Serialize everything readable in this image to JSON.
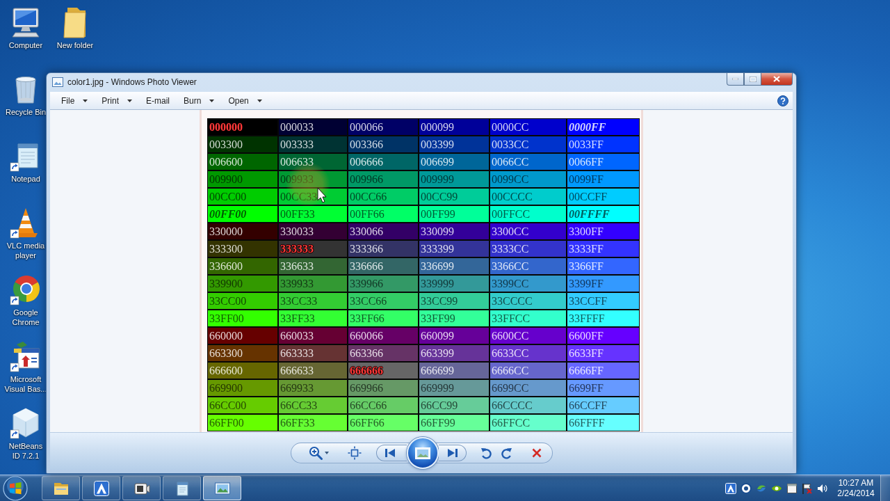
{
  "desktop": {
    "icons": [
      {
        "label": "Computer",
        "kind": "computer",
        "shortcut": false
      },
      {
        "label": "Recycle Bin",
        "kind": "recycle_bin",
        "shortcut": false
      },
      {
        "label": "Notepad",
        "kind": "notepad",
        "shortcut": true
      },
      {
        "label": "VLC media player",
        "kind": "cone",
        "shortcut": true
      },
      {
        "label": "Google Chrome",
        "kind": "browser",
        "shortcut": true
      },
      {
        "label": "Microsoft Visual Bas...",
        "kind": "vb",
        "shortcut": true
      },
      {
        "label": "NetBeans ID 7.2.1",
        "kind": "cube",
        "shortcut": true
      },
      {
        "label": "New folder",
        "kind": "folder",
        "shortcut": false
      }
    ]
  },
  "window": {
    "title": "color1.jpg - Windows Photo Viewer",
    "menu": [
      {
        "label": "File",
        "dropdown": true
      },
      {
        "label": "Print",
        "dropdown": true
      },
      {
        "label": "E-mail",
        "dropdown": false
      },
      {
        "label": "Burn",
        "dropdown": true
      },
      {
        "label": "Open",
        "dropdown": true
      }
    ],
    "image": {
      "table": {
        "rows": [
          {
            "cells": [
              {
                "text": "000000",
                "color": "#000000",
                "kind": "highlight"
              },
              {
                "text": "000033",
                "color": "#000033",
                "kind": "plain"
              },
              {
                "text": "000066",
                "color": "#000066",
                "kind": "plain"
              },
              {
                "text": "000099",
                "color": "#000099",
                "kind": "plain"
              },
              {
                "text": "0000CC",
                "color": "#0000CC",
                "kind": "plain"
              },
              {
                "text": "0000FF",
                "color": "#0000FF",
                "kind": "emphasis"
              }
            ]
          },
          {
            "cells": [
              {
                "text": "003300",
                "color": "#003300",
                "kind": "plain"
              },
              {
                "text": "003333",
                "color": "#003333",
                "kind": "plain"
              },
              {
                "text": "003366",
                "color": "#003366",
                "kind": "plain"
              },
              {
                "text": "003399",
                "color": "#003399",
                "kind": "plain"
              },
              {
                "text": "0033CC",
                "color": "#0033CC",
                "kind": "plain"
              },
              {
                "text": "0033FF",
                "color": "#0033FF",
                "kind": "plain"
              }
            ]
          },
          {
            "cells": [
              {
                "text": "006600",
                "color": "#006600",
                "kind": "plain"
              },
              {
                "text": "006633",
                "color": "#006633",
                "kind": "plain"
              },
              {
                "text": "006666",
                "color": "#006666",
                "kind": "plain"
              },
              {
                "text": "006699",
                "color": "#006699",
                "kind": "plain"
              },
              {
                "text": "0066CC",
                "color": "#0066CC",
                "kind": "plain"
              },
              {
                "text": "0066FF",
                "color": "#0066FF",
                "kind": "plain"
              }
            ]
          },
          {
            "cells": [
              {
                "text": "009900",
                "color": "#009900",
                "kind": "plain"
              },
              {
                "text": "009933",
                "color": "#009933",
                "kind": "plain"
              },
              {
                "text": "009966",
                "color": "#009966",
                "kind": "plain"
              },
              {
                "text": "009999",
                "color": "#009999",
                "kind": "plain"
              },
              {
                "text": "0099CC",
                "color": "#0099CC",
                "kind": "plain"
              },
              {
                "text": "0099FF",
                "color": "#0099FF",
                "kind": "plain"
              }
            ]
          },
          {
            "cells": [
              {
                "text": "00CC00",
                "color": "#00CC00",
                "kind": "plain"
              },
              {
                "text": "00CC33",
                "color": "#00CC33",
                "kind": "plain"
              },
              {
                "text": "00CC66",
                "color": "#00CC66",
                "kind": "plain"
              },
              {
                "text": "00CC99",
                "color": "#00CC99",
                "kind": "plain"
              },
              {
                "text": "00CCCC",
                "color": "#00CCCC",
                "kind": "plain"
              },
              {
                "text": "00CCFF",
                "color": "#00CCFF",
                "kind": "plain"
              }
            ]
          },
          {
            "cells": [
              {
                "text": "00FF00",
                "color": "#00FF00",
                "kind": "emphasis"
              },
              {
                "text": "00FF33",
                "color": "#00FF33",
                "kind": "plain"
              },
              {
                "text": "00FF66",
                "color": "#00FF66",
                "kind": "plain"
              },
              {
                "text": "00FF99",
                "color": "#00FF99",
                "kind": "plain"
              },
              {
                "text": "00FFCC",
                "color": "#00FFCC",
                "kind": "plain"
              },
              {
                "text": "00FFFF",
                "color": "#00FFFF",
                "kind": "emphasis"
              }
            ]
          },
          {
            "cells": [
              {
                "text": "330000",
                "color": "#330000",
                "kind": "plain"
              },
              {
                "text": "330033",
                "color": "#330033",
                "kind": "plain"
              },
              {
                "text": "330066",
                "color": "#330066",
                "kind": "plain"
              },
              {
                "text": "330099",
                "color": "#330099",
                "kind": "plain"
              },
              {
                "text": "3300CC",
                "color": "#3300CC",
                "kind": "plain"
              },
              {
                "text": "3300FF",
                "color": "#3300FF",
                "kind": "plain"
              }
            ]
          },
          {
            "cells": [
              {
                "text": "333300",
                "color": "#333300",
                "kind": "plain"
              },
              {
                "text": "333333",
                "color": "#333333",
                "kind": "highlight"
              },
              {
                "text": "333366",
                "color": "#333366",
                "kind": "plain"
              },
              {
                "text": "333399",
                "color": "#333399",
                "kind": "plain"
              },
              {
                "text": "3333CC",
                "color": "#3333CC",
                "kind": "plain"
              },
              {
                "text": "3333FF",
                "color": "#3333FF",
                "kind": "plain"
              }
            ]
          },
          {
            "cells": [
              {
                "text": "336600",
                "color": "#336600",
                "kind": "plain"
              },
              {
                "text": "336633",
                "color": "#336633",
                "kind": "plain"
              },
              {
                "text": "336666",
                "color": "#336666",
                "kind": "plain"
              },
              {
                "text": "336699",
                "color": "#336699",
                "kind": "plain"
              },
              {
                "text": "3366CC",
                "color": "#3366CC",
                "kind": "plain"
              },
              {
                "text": "3366FF",
                "color": "#3366FF",
                "kind": "plain"
              }
            ]
          },
          {
            "cells": [
              {
                "text": "339900",
                "color": "#339900",
                "kind": "plain"
              },
              {
                "text": "339933",
                "color": "#339933",
                "kind": "plain"
              },
              {
                "text": "339966",
                "color": "#339966",
                "kind": "plain"
              },
              {
                "text": "339999",
                "color": "#339999",
                "kind": "plain"
              },
              {
                "text": "3399CC",
                "color": "#3399CC",
                "kind": "plain"
              },
              {
                "text": "3399FF",
                "color": "#3399FF",
                "kind": "plain"
              }
            ]
          },
          {
            "cells": [
              {
                "text": "33CC00",
                "color": "#33CC00",
                "kind": "plain"
              },
              {
                "text": "33CC33",
                "color": "#33CC33",
                "kind": "plain"
              },
              {
                "text": "33CC66",
                "color": "#33CC66",
                "kind": "plain"
              },
              {
                "text": "33CC99",
                "color": "#33CC99",
                "kind": "plain"
              },
              {
                "text": "33CCCC",
                "color": "#33CCCC",
                "kind": "plain"
              },
              {
                "text": "33CCFF",
                "color": "#33CCFF",
                "kind": "plain"
              }
            ]
          },
          {
            "cells": [
              {
                "text": "33FF00",
                "color": "#33FF00",
                "kind": "plain"
              },
              {
                "text": "33FF33",
                "color": "#33FF33",
                "kind": "plain"
              },
              {
                "text": "33FF66",
                "color": "#33FF66",
                "kind": "plain"
              },
              {
                "text": "33FF99",
                "color": "#33FF99",
                "kind": "plain"
              },
              {
                "text": "33FFCC",
                "color": "#33FFCC",
                "kind": "plain"
              },
              {
                "text": "33FFFF",
                "color": "#33FFFF",
                "kind": "plain"
              }
            ]
          },
          {
            "cells": [
              {
                "text": "660000",
                "color": "#660000",
                "kind": "plain"
              },
              {
                "text": "660033",
                "color": "#660033",
                "kind": "plain"
              },
              {
                "text": "660066",
                "color": "#660066",
                "kind": "plain"
              },
              {
                "text": "660099",
                "color": "#660099",
                "kind": "plain"
              },
              {
                "text": "6600CC",
                "color": "#6600CC",
                "kind": "plain"
              },
              {
                "text": "6600FF",
                "color": "#6600FF",
                "kind": "plain"
              }
            ]
          },
          {
            "cells": [
              {
                "text": "663300",
                "color": "#663300",
                "kind": "plain"
              },
              {
                "text": "663333",
                "color": "#663333",
                "kind": "plain"
              },
              {
                "text": "663366",
                "color": "#663366",
                "kind": "plain"
              },
              {
                "text": "663399",
                "color": "#663399",
                "kind": "plain"
              },
              {
                "text": "6633CC",
                "color": "#6633CC",
                "kind": "plain"
              },
              {
                "text": "6633FF",
                "color": "#6633FF",
                "kind": "plain"
              }
            ]
          },
          {
            "cells": [
              {
                "text": "666600",
                "color": "#666600",
                "kind": "plain"
              },
              {
                "text": "666633",
                "color": "#666633",
                "kind": "plain"
              },
              {
                "text": "666666",
                "color": "#666666",
                "kind": "highlight"
              },
              {
                "text": "666699",
                "color": "#666699",
                "kind": "plain"
              },
              {
                "text": "6666CC",
                "color": "#6666CC",
                "kind": "plain"
              },
              {
                "text": "6666FF",
                "color": "#6666FF",
                "kind": "plain"
              }
            ]
          },
          {
            "cells": [
              {
                "text": "669900",
                "color": "#669900",
                "kind": "plain"
              },
              {
                "text": "669933",
                "color": "#669933",
                "kind": "plain"
              },
              {
                "text": "669966",
                "color": "#669966",
                "kind": "plain"
              },
              {
                "text": "669999",
                "color": "#669999",
                "kind": "plain"
              },
              {
                "text": "6699CC",
                "color": "#6699CC",
                "kind": "plain"
              },
              {
                "text": "6699FF",
                "color": "#6699FF",
                "kind": "plain"
              }
            ]
          },
          {
            "cells": [
              {
                "text": "66CC00",
                "color": "#66CC00",
                "kind": "plain"
              },
              {
                "text": "66CC33",
                "color": "#66CC33",
                "kind": "plain"
              },
              {
                "text": "66CC66",
                "color": "#66CC66",
                "kind": "plain"
              },
              {
                "text": "66CC99",
                "color": "#66CC99",
                "kind": "plain"
              },
              {
                "text": "66CCCC",
                "color": "#66CCCC",
                "kind": "plain"
              },
              {
                "text": "66CCFF",
                "color": "#66CCFF",
                "kind": "plain"
              }
            ]
          },
          {
            "cells": [
              {
                "text": "66FF00",
                "color": "#66FF00",
                "kind": "plain"
              },
              {
                "text": "66FF33",
                "color": "#66FF33",
                "kind": "plain"
              },
              {
                "text": "66FF66",
                "color": "#66FF66",
                "kind": "plain"
              },
              {
                "text": "66FF99",
                "color": "#66FF99",
                "kind": "plain"
              },
              {
                "text": "66FFCC",
                "color": "#66FFCC",
                "kind": "plain"
              },
              {
                "text": "66FFFF",
                "color": "#66FFFF",
                "kind": "plain"
              }
            ]
          }
        ]
      }
    }
  },
  "taskbar": {
    "buttons": [
      {
        "kind": "explorer",
        "selected": false
      },
      {
        "kind": "triangle_app",
        "selected": false
      },
      {
        "kind": "camera",
        "selected": false
      },
      {
        "kind": "notepad",
        "selected": false
      },
      {
        "kind": "photo_viewer",
        "selected": true
      }
    ],
    "clock": {
      "time": "10:27 AM",
      "date": "2/24/2014"
    }
  }
}
